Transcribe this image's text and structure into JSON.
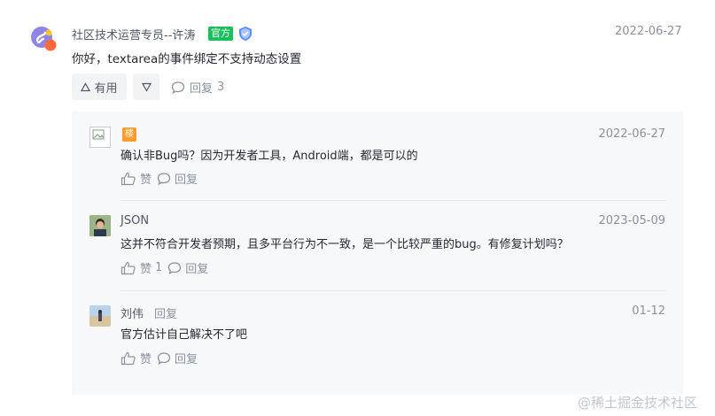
{
  "comment": {
    "author": "社区技术运营专员--许涛",
    "official_label": "官方",
    "date": "2022-06-27",
    "text": "你好，textarea的事件绑定不支持动态设置",
    "useful_label": "有用",
    "reply_label": "回复",
    "reply_count": "3"
  },
  "replies": [
    {
      "name": "",
      "floor_label": "楼",
      "date": "2022-06-27",
      "text": "确认非Bug吗？因为开发者工具，Android端，都是可以的",
      "like_label": "赞",
      "like_count": "",
      "reply_label": "回复"
    },
    {
      "name": "JSON",
      "date": "2023-05-09",
      "text": "这并不符合开发者预期，且多平台行为不一致，是一个比较严重的bug。有修复计划吗？",
      "like_label": "赞",
      "like_count": "1",
      "reply_label": "回复"
    },
    {
      "name": "刘伟",
      "reply_tag": "回复",
      "date": "01-12",
      "text": "官方估计自己解决不了吧",
      "like_label": "赞",
      "like_count": "",
      "reply_label": "回复"
    }
  ],
  "watermark": "@稀土掘金技术社区",
  "colors": {
    "official_green": "#1bbf5d",
    "floor_orange": "#ff9d2b",
    "panel_bg": "#f7f8fa",
    "muted_text": "#8a919f"
  },
  "icons": [
    "mini-program-logo-icon",
    "shield-icon",
    "thumb-up-icon",
    "thumb-down-icon",
    "comment-icon"
  ]
}
